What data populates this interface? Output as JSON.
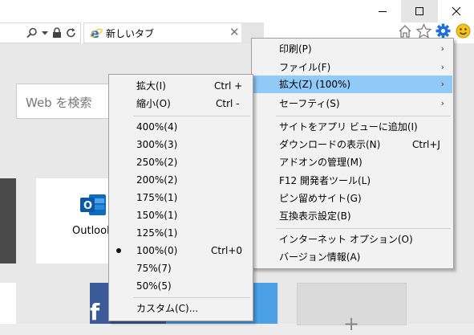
{
  "tab": {
    "title": "新しいタブ"
  },
  "page": {
    "search_placeholder": "Web を検索",
    "tiles": [
      "Outlook"
    ]
  },
  "main_menu": [
    {
      "label": "印刷(P)",
      "arrow": "›"
    },
    {
      "label": "ファイル(F)",
      "arrow": "›"
    },
    {
      "label": "拡大(Z) (100%)",
      "arrow": "›",
      "highlighted": true
    },
    {
      "label": "セーフティ(S)",
      "arrow": "›"
    },
    {
      "label": "サイトをアプリ ビューに追加(I)"
    },
    {
      "label": "ダウンロードの表示(N)",
      "shortcut": "Ctrl+J"
    },
    {
      "label": "アドオンの管理(M)"
    },
    {
      "label": "F12 開発者ツール(L)"
    },
    {
      "label": "ピン留めサイト(G)"
    },
    {
      "label": "互換表示設定(B)"
    },
    {
      "label": "インターネット オプション(O)"
    },
    {
      "label": "バージョン情報(A)"
    }
  ],
  "zoom_menu": [
    {
      "label": "拡大(I)",
      "shortcut": "Ctrl +"
    },
    {
      "label": "縮小(O)",
      "shortcut": "Ctrl -"
    },
    {
      "label": "400%(4)"
    },
    {
      "label": "300%(3)"
    },
    {
      "label": "250%(2)"
    },
    {
      "label": "200%(2)"
    },
    {
      "label": "175%(1)"
    },
    {
      "label": "150%(1)"
    },
    {
      "label": "125%(1)"
    },
    {
      "label": "100%(0)",
      "shortcut": "Ctrl+0",
      "checked": true
    },
    {
      "label": "75%(7)"
    },
    {
      "label": "50%(5)"
    },
    {
      "label": "カスタム(C)..."
    }
  ],
  "colors": {
    "highlight": "#91c9f7",
    "facebook": "#3b5a99",
    "accent_blue": "#1e6fd9",
    "smiley": "#f4c21a"
  }
}
